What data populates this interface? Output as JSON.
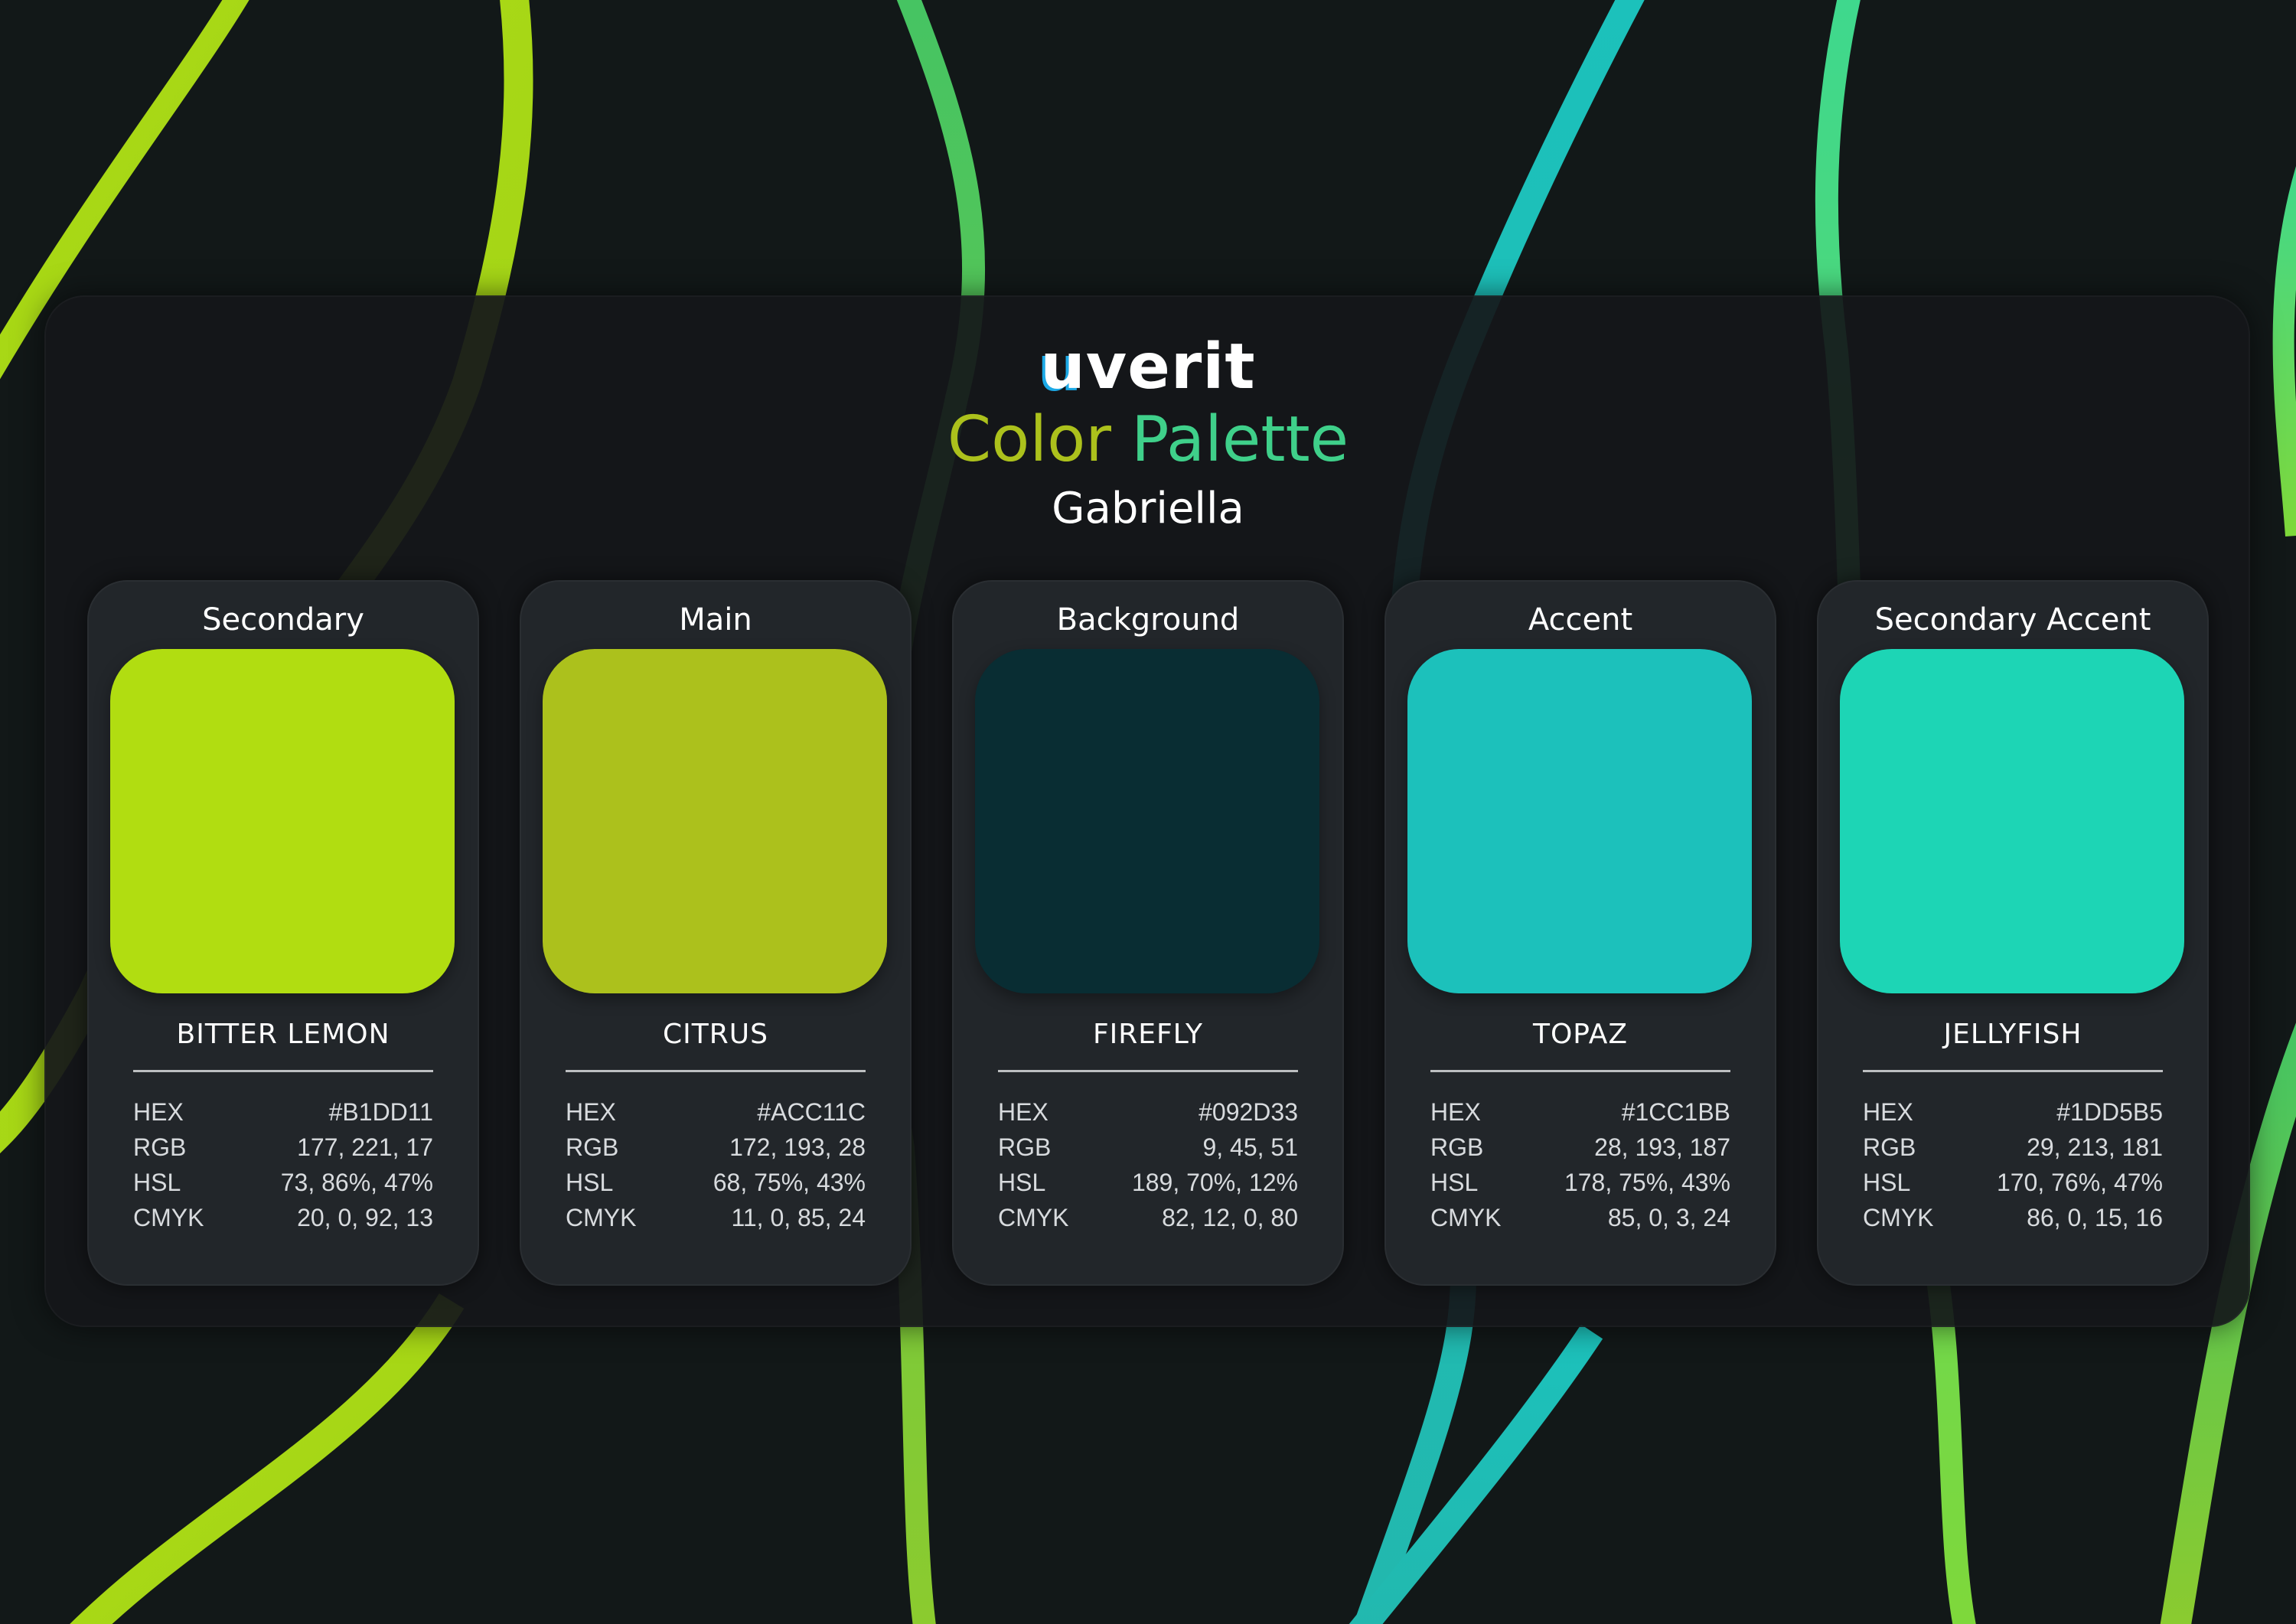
{
  "brand": {
    "logo_u": "u",
    "logo_rest": "verit"
  },
  "header": {
    "title_word1": "Color",
    "title_word2": "Palette",
    "subtitle": "Gabriella"
  },
  "colors": {
    "bg": "#121818",
    "panel": "#15181B",
    "card": "#22262A",
    "ribbon_lime": "#B1DD11",
    "ribbon_green": "#6CC24A",
    "ribbon_teal": "#1CC1BB",
    "ribbon_jelly": "#3FD08A"
  },
  "labels": {
    "hex": "HEX",
    "rgb": "RGB",
    "hsl": "HSL",
    "cmyk": "CMYK"
  },
  "cards": [
    {
      "label": "Secondary",
      "name": "BITTER LEMON",
      "color": "#B1DD11",
      "hex": "#B1DD11",
      "rgb": "177, 221, 17",
      "hsl": "73, 86%, 47%",
      "cmyk": "20, 0, 92, 13"
    },
    {
      "label": "Main",
      "name": "CITRUS",
      "color": "#ACC11C",
      "hex": "#ACC11C",
      "rgb": "172, 193, 28",
      "hsl": "68, 75%, 43%",
      "cmyk": "11, 0, 85, 24"
    },
    {
      "label": "Background",
      "name": "FIREFLY",
      "color": "#092D33",
      "hex": "#092D33",
      "rgb": "9, 45, 51",
      "hsl": "189, 70%, 12%",
      "cmyk": "82, 12, 0, 80"
    },
    {
      "label": "Accent",
      "name": "TOPAZ",
      "color": "#1CC1BB",
      "hex": "#1CC1BB",
      "rgb": "28, 193, 187",
      "hsl": "178, 75%, 43%",
      "cmyk": "85, 0, 3, 24"
    },
    {
      "label": "Secondary Accent",
      "name": "JELLYFISH",
      "color": "#1DD5B5",
      "hex": "#1DD5B5",
      "rgb": "29, 213, 181",
      "hsl": "170, 76%, 47%",
      "cmyk": "86, 0, 15, 16"
    }
  ]
}
